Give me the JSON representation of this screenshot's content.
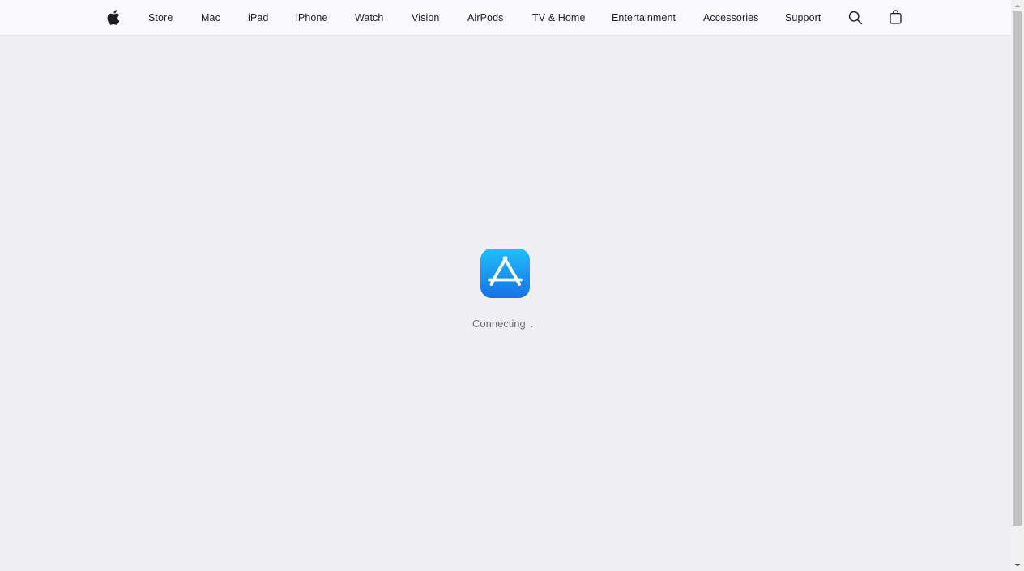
{
  "nav": {
    "logo_icon": "apple-logo-icon",
    "items": [
      "Store",
      "Mac",
      "iPad",
      "iPhone",
      "Watch",
      "Vision",
      "AirPods",
      "TV & Home",
      "Entertainment",
      "Accessories",
      "Support"
    ],
    "search_icon": "search-icon",
    "bag_icon": "shopping-bag-icon"
  },
  "loader": {
    "icon": "app-store-icon",
    "status": "Connecting",
    "dots": "."
  },
  "colors": {
    "nav_bg": "#fafafc",
    "page_bg": "#efeff4",
    "text": "#1d1d1f",
    "status_text": "#6e6e73",
    "appstore_gradient_top": "#1ec0fb",
    "appstore_gradient_bottom": "#1771e6"
  }
}
